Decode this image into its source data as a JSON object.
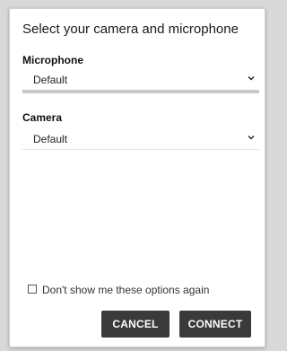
{
  "dialog": {
    "title": "Select your camera and microphone",
    "microphone": {
      "label": "Microphone",
      "value": "Default"
    },
    "camera": {
      "label": "Camera",
      "value": "Default"
    },
    "checkbox": {
      "label": "Don't show me these options again",
      "checked": false
    },
    "buttons": {
      "cancel": "CANCEL",
      "connect": "CONNECT"
    }
  },
  "icons": {
    "dropdown": "chevron-down-icon"
  },
  "colors": {
    "button_bg": "#3a3a3a",
    "button_text": "#ffffff"
  }
}
